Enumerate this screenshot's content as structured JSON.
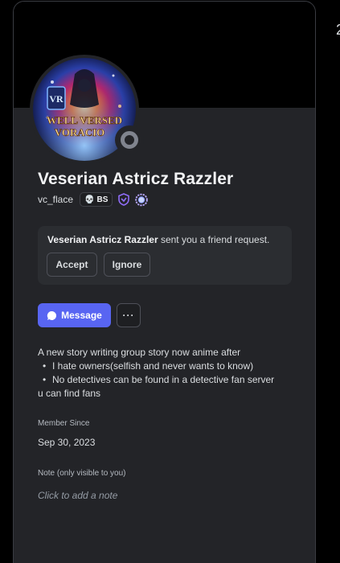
{
  "profile": {
    "display_name": "Veserian Astricz Razzler",
    "username": "vc_flace",
    "server_tag": "BS",
    "server_tag_icon": "skull-emoji",
    "status": "offline",
    "avatar_caption_line1": "WELL VERSED",
    "avatar_caption_line2": "VORACIO",
    "avatar_corner_text": "VR"
  },
  "badges": [
    "nitro-shield-badge",
    "boost-gem-badge"
  ],
  "friend_request": {
    "name": "Veserian Astricz Razzler",
    "message": " sent you a friend request.",
    "accept_label": "Accept",
    "ignore_label": "Ignore"
  },
  "actions": {
    "message_label": "Message",
    "more_label": "···"
  },
  "bio": {
    "line1": "A new story writing group story now anime after",
    "bullets": [
      "I hate owners(selfish and never wants to know)",
      "No detectives can be found in a detective fan server"
    ],
    "line_last": "u can find fans",
    "bullet_char": "•"
  },
  "member_since": {
    "label": "Member Since",
    "value": "Sep 30, 2023"
  },
  "note": {
    "label": "Note (only visible to you)",
    "placeholder": "Click to add a note"
  },
  "colors": {
    "background": "#000000",
    "card": "#232428",
    "accent": "#5865f2",
    "status_offline": "#80848e",
    "nitro_badge": "#8f6df7",
    "boost_badge": "#b6a6f9"
  }
}
